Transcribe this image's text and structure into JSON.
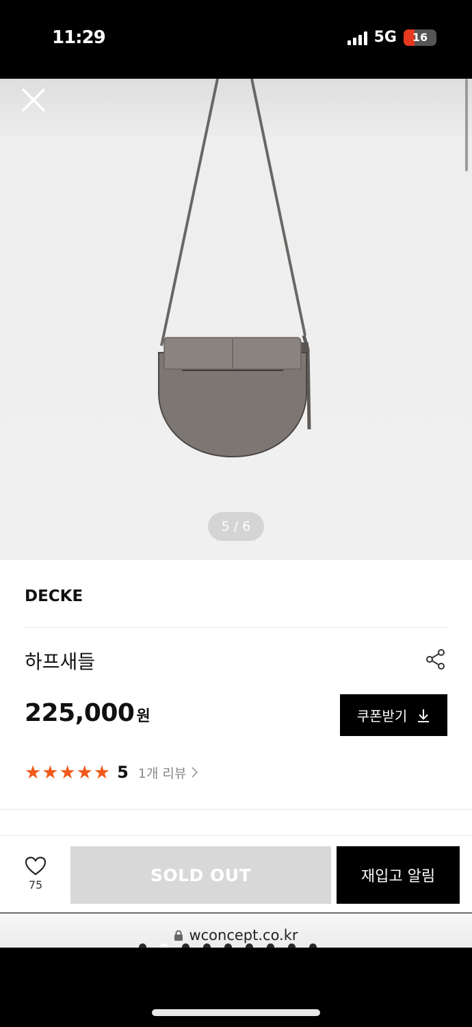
{
  "status": {
    "time": "11:29",
    "network": "5G",
    "battery": "16",
    "battery_level": 0.16
  },
  "gallery": {
    "indicator": "5 / 6"
  },
  "product": {
    "brand": "DECKE",
    "name": "하프새들",
    "price": "225,000",
    "currency": "원",
    "coupon_label": "쿠폰받기",
    "rating": "5",
    "rating_stars": 5,
    "review_label": "1개 리뷰"
  },
  "actions": {
    "like_count": "75",
    "soldout_label": "SOLD OUT",
    "restock_label": "재입고 알림"
  },
  "browser": {
    "url": "wconcept.co.kr"
  },
  "colors": {
    "accent_star": "#f05a1a",
    "battery_low": "#e53a1f",
    "soldout_bg": "#d8d8d8",
    "primary_button": "#000000"
  },
  "icons": [
    "close-icon",
    "share-icon",
    "download-icon",
    "heart-icon",
    "lock-icon",
    "chevron-right-icon",
    "star-icon"
  ]
}
